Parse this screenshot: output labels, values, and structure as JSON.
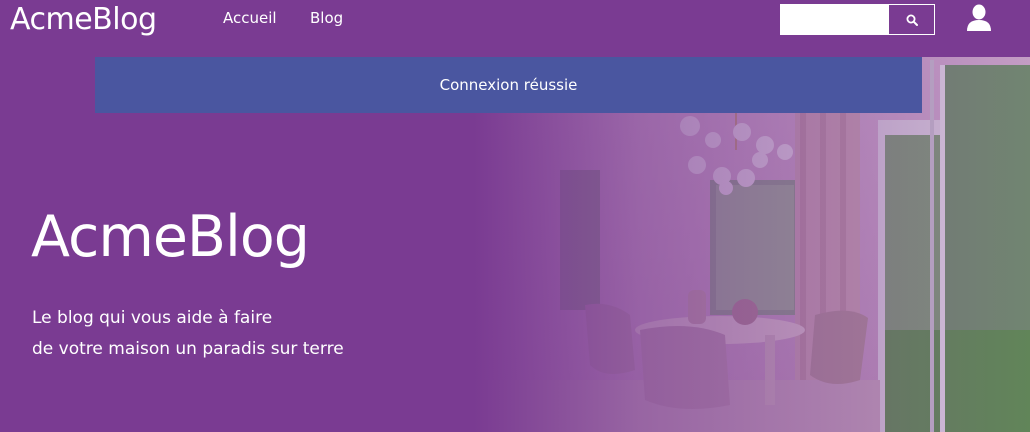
{
  "nav": {
    "logo": "AcmeBlog",
    "links": [
      {
        "label": "Accueil"
      },
      {
        "label": "Blog"
      }
    ],
    "search": {
      "value": "",
      "placeholder": "",
      "button_icon": "search-icon"
    },
    "user_icon": "user-icon"
  },
  "alert": {
    "text": "Connexion réussie"
  },
  "hero": {
    "title": "AcmeBlog",
    "subtitle_line1": "Le blog qui vous aide à faire",
    "subtitle_line2": "de votre maison un paradis sur terre"
  },
  "colors": {
    "brand_purple": "#7a3b92",
    "alert_blue": "#4a56a0",
    "text": "#ffffff"
  }
}
